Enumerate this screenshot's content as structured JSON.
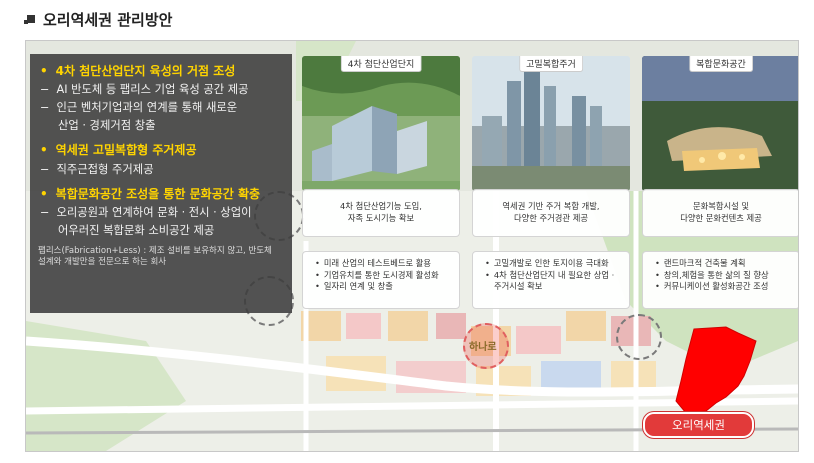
{
  "heading": {
    "title": "오리역세권 관리방안"
  },
  "overview": {
    "sections": [
      {
        "title": "4차 첨단산업단지 육성의 거점 조성",
        "items": [
          {
            "lines": [
              "AI 반도체 등 팹리스 기업 육성 공간 제공"
            ]
          },
          {
            "lines": [
              "인근 벤처기업과의 연계를 통해 새로운",
              "산업 · 경제거점 창출"
            ]
          }
        ]
      },
      {
        "title": "역세권 고밀복합형 주거제공",
        "items": [
          {
            "lines": [
              "직주근접형 주거제공"
            ]
          }
        ]
      },
      {
        "title": "복합문화공간 조성을 통한 문화공간 확충",
        "items": [
          {
            "lines": [
              "오리공원과 연계하여 문화 · 전시 · 상업이",
              "어우러진 복합문화 소비공간 제공"
            ]
          }
        ]
      }
    ],
    "note": [
      "팹리스(Fabrication+Less) : 제조 설비를 보유하지 않고, 반도체",
      "설계와 개발만을 전문으로 하는 회사"
    ]
  },
  "tiles": [
    {
      "label": "4차 첨단산업단지",
      "desc": [
        "4차 첨단산업기능 도입,",
        "자족 도시기능 확보"
      ],
      "points": [
        "미래 산업의 테스트베드로 활용",
        "기업유치를 통한 도시경제 활성화",
        "일자리 연계 및 창출"
      ]
    },
    {
      "label": "고밀복합주거",
      "desc": [
        "역세권 기반 주거 복합 개발,",
        "다양한 주거경관 제공"
      ],
      "points": [
        "고밀개발로 인한 토지이용 극대화",
        "4차 첨단산업단지 내 필요한 상업 ·",
        "주거시설 확보"
      ]
    },
    {
      "label": "복합문화공간",
      "desc": [
        "문화복합시설 및",
        "다양한 문화컨텐츠 제공"
      ],
      "points": [
        "랜드마크적 건축물 계획",
        "창의,체험을 통한 삶의 질 향상",
        "커뮤니케이션 활성화공간 조성"
      ]
    }
  ],
  "map": {
    "place_label": "하나로",
    "station_label": "오리역세권"
  },
  "colors": {
    "highlight": "#ffd400",
    "station_red": "#e23a3a",
    "overlay_bg": "#3c3c3c"
  }
}
